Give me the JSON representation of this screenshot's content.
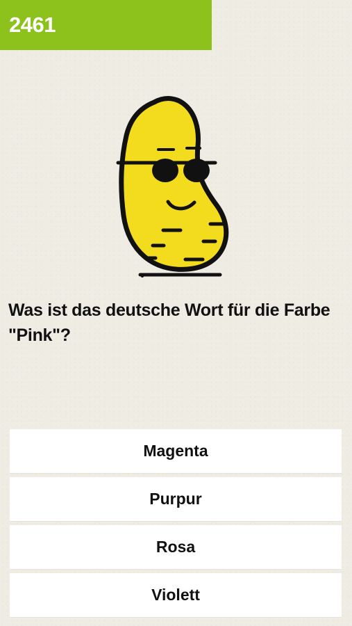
{
  "score": "2461",
  "colors": {
    "score_badge": "#8cc21b",
    "potato_fill": "#f2dc1d",
    "outline": "#111111",
    "background": "#efece4",
    "answer_bg": "#ffffff"
  },
  "mascot": {
    "icon": "potato-with-sunglasses-icon"
  },
  "question": "Was ist das deutsche Wort für die Farbe \"Pink\"?",
  "answers": [
    {
      "label": "Magenta"
    },
    {
      "label": "Purpur"
    },
    {
      "label": "Rosa"
    },
    {
      "label": "Violett"
    }
  ]
}
